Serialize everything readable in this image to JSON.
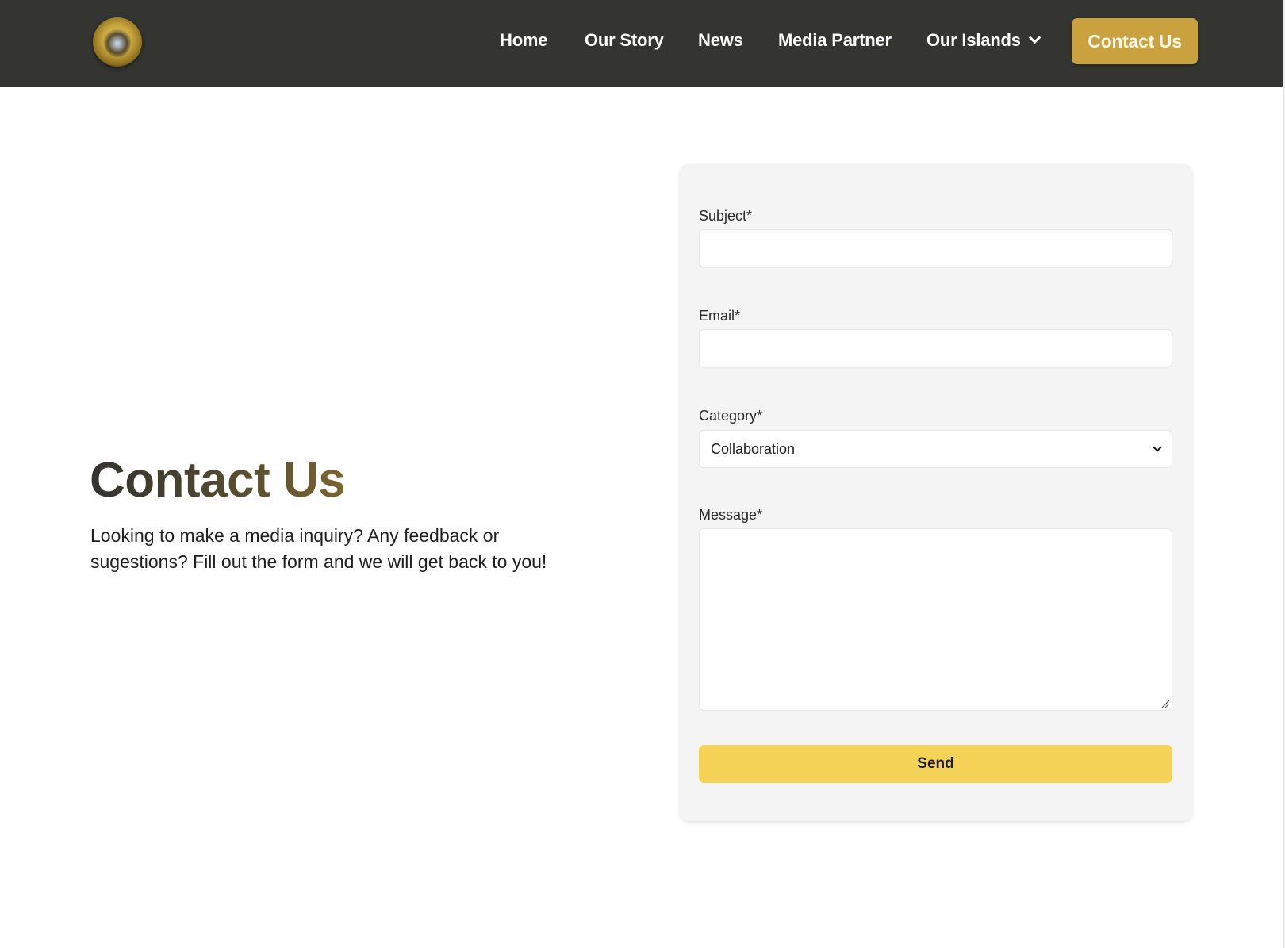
{
  "header": {
    "logo_icon": "crest-emblem-icon",
    "nav": [
      {
        "label": "Home"
      },
      {
        "label": "Our Story"
      },
      {
        "label": "News"
      },
      {
        "label": "Media Partner"
      },
      {
        "label": "Our Islands",
        "has_dropdown": true,
        "icon": "chevron-down-icon"
      }
    ],
    "cta_label": "Contact Us"
  },
  "intro": {
    "title": "Contact Us",
    "text": "Looking to make a media inquiry? Any feedback or sugestions? Fill out the form and we will get back to you!"
  },
  "form": {
    "subject": {
      "label": "Subject*",
      "value": "",
      "placeholder": ""
    },
    "email": {
      "label": "Email*",
      "value": "",
      "placeholder": ""
    },
    "category": {
      "label": "Category*",
      "selected": "Collaboration",
      "icon": "chevron-down-icon"
    },
    "message": {
      "label": "Message*",
      "value": "",
      "placeholder": ""
    },
    "submit_label": "Send"
  },
  "colors": {
    "header_bg": "#343431",
    "cta_bg": "#c9a13f",
    "send_bg": "#f4d357",
    "card_bg": "#f4f4f4",
    "title_gradient_start": "#333331",
    "title_gradient_end": "#7a6530"
  }
}
